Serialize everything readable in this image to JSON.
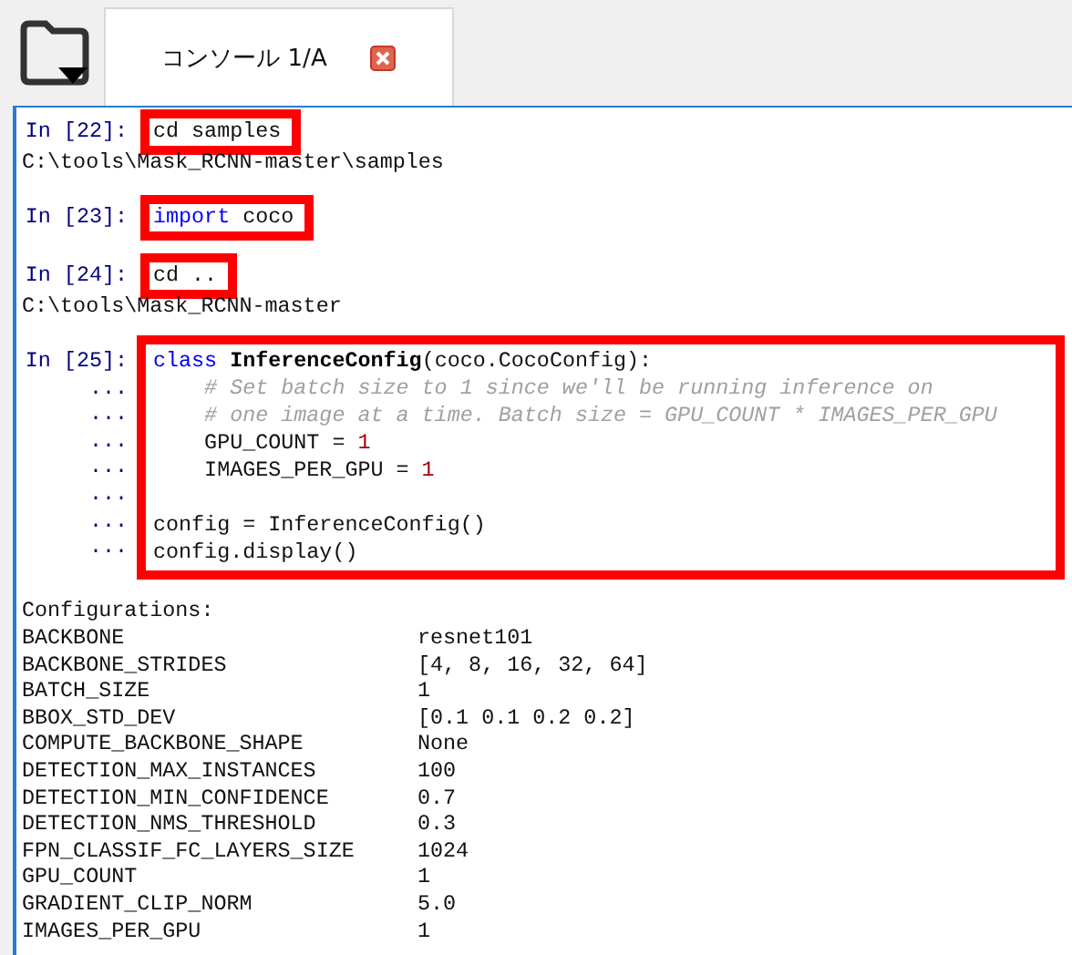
{
  "tabs": [
    {
      "label": "コンソール 1/A",
      "selected": true
    }
  ],
  "console": [
    {
      "kind": "input",
      "prompt": "In [22]:",
      "highlighted": true,
      "lines": [
        {
          "kind": "code",
          "tokens": [
            {
              "text": "cd samples",
              "kind": "plain"
            }
          ]
        }
      ]
    },
    {
      "kind": "output",
      "text": "C:\\tools\\Mask_RCNN-master\\samples"
    },
    {
      "kind": "blank"
    },
    {
      "kind": "input",
      "prompt": "In [23]:",
      "highlighted": true,
      "lines": [
        {
          "kind": "code",
          "tokens": [
            {
              "text": "import",
              "kind": "keyword"
            },
            {
              "text": " coco",
              "kind": "plain"
            }
          ]
        }
      ]
    },
    {
      "kind": "blank"
    },
    {
      "kind": "input",
      "prompt": "In [24]:",
      "highlighted": true,
      "lines": [
        {
          "kind": "code",
          "tokens": [
            {
              "text": "cd ..",
              "kind": "plain"
            }
          ]
        }
      ]
    },
    {
      "kind": "output",
      "text": "C:\\tools\\Mask_RCNN-master"
    },
    {
      "kind": "blank"
    },
    {
      "kind": "input",
      "prompt": "In [25]:",
      "continuation": "...",
      "highlighted": true,
      "lines": [
        {
          "kind": "code",
          "tokens": [
            {
              "text": "class ",
              "kind": "keyword"
            },
            {
              "text": "InferenceConfig",
              "kind": "classname"
            },
            {
              "text": "(coco.CocoConfig):",
              "kind": "plain"
            }
          ]
        },
        {
          "kind": "code",
          "tokens": [
            {
              "text": "    # Set batch size to 1 since we'll be running inference on",
              "kind": "comment"
            }
          ]
        },
        {
          "kind": "code",
          "tokens": [
            {
              "text": "    # one image at a time. Batch size = GPU_COUNT * IMAGES_PER_GPU",
              "kind": "comment"
            }
          ]
        },
        {
          "kind": "code",
          "tokens": [
            {
              "text": "    GPU_COUNT = ",
              "kind": "plain"
            },
            {
              "text": "1",
              "kind": "number"
            }
          ]
        },
        {
          "kind": "code",
          "tokens": [
            {
              "text": "    IMAGES_PER_GPU = ",
              "kind": "plain"
            },
            {
              "text": "1",
              "kind": "number"
            }
          ]
        },
        {
          "kind": "blank"
        },
        {
          "kind": "code",
          "tokens": [
            {
              "text": "config = InferenceConfig()",
              "kind": "plain"
            }
          ]
        },
        {
          "kind": "code",
          "tokens": [
            {
              "text": "config.display()",
              "kind": "plain"
            }
          ]
        }
      ]
    },
    {
      "kind": "blank"
    },
    {
      "kind": "output",
      "text": "Configurations:"
    },
    {
      "kind": "table",
      "rows": [
        [
          "BACKBONE",
          "resnet101"
        ],
        [
          "BACKBONE_STRIDES",
          "[4, 8, 16, 32, 64]"
        ],
        [
          "BATCH_SIZE",
          "1"
        ],
        [
          "BBOX_STD_DEV",
          "[0.1 0.1 0.2 0.2]"
        ],
        [
          "COMPUTE_BACKBONE_SHAPE",
          "None"
        ],
        [
          "DETECTION_MAX_INSTANCES",
          "100"
        ],
        [
          "DETECTION_MIN_CONFIDENCE",
          "0.7"
        ],
        [
          "DETECTION_NMS_THRESHOLD",
          "0.3"
        ],
        [
          "FPN_CLASSIF_FC_LAYERS_SIZE",
          "1024"
        ],
        [
          "GPU_COUNT",
          "1"
        ],
        [
          "GRADIENT_CLIP_NORM",
          "5.0"
        ],
        [
          "IMAGES_PER_GPU",
          "1"
        ]
      ]
    }
  ]
}
